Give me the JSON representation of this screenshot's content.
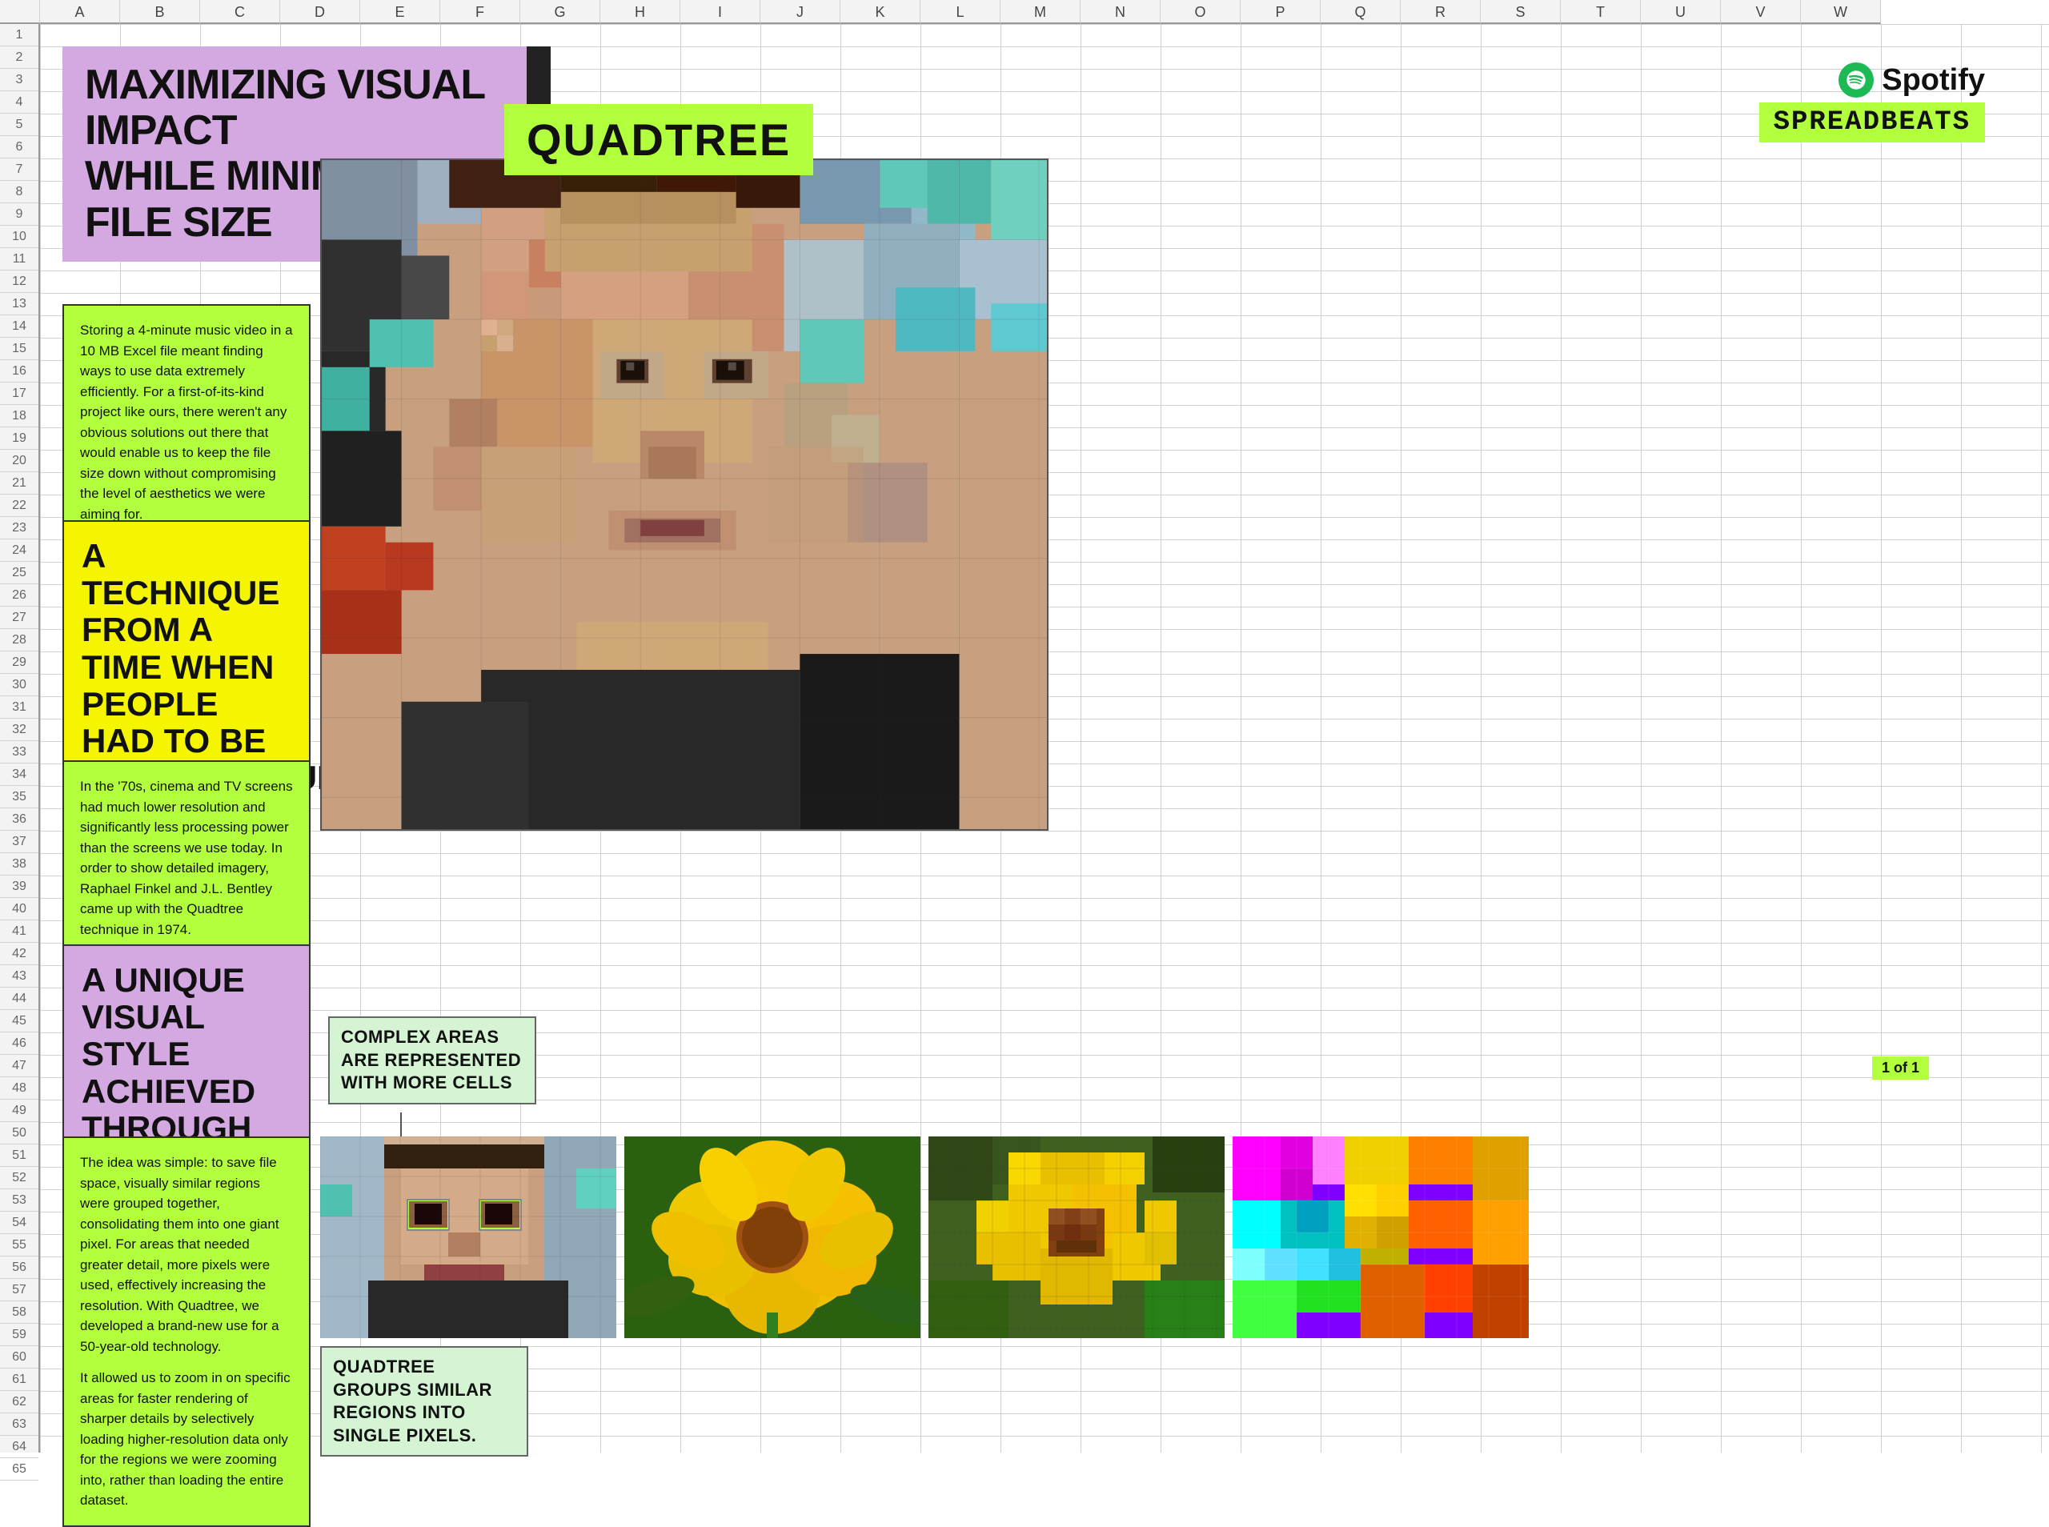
{
  "page": {
    "title": "Maximizing Visual Impact While Minimizing File Size",
    "quadtree_label": "QUADTREE",
    "spreadbeats": "SPREADBEATS"
  },
  "spotify": {
    "name": "Spotify",
    "logo_alt": "spotify-logo"
  },
  "title_block": {
    "line1": "MAXIMIZING VISUAL IMPACT",
    "line2": "WHILE MINIMIZING FILE SIZE"
  },
  "intro_box": {
    "text": "Storing a 4-minute music video in a 10 MB Excel file meant finding ways to use data extremely efficiently. For a first-of-its-kind project like ours, there weren't any obvious solutions out there that would enable us to keep the file size down without compromising the level of aesthetics we were aiming for."
  },
  "yellow_heading": {
    "text": "A TECHNIQUE FROM A TIME WHEN PEOPLE HAD TO BE RESOURCEFUL"
  },
  "seventies_box": {
    "text": "In the '70s, cinema and TV screens had much lower resolution and significantly less processing power than the screens we use today. In order to show detailed imagery, Raphael Finkel and J.L. Bentley came up with the Quadtree technique in 1974."
  },
  "purple_heading": {
    "text": "A UNIQUE VISUAL STYLE ACHIEVED THROUGH DATA EFFICIENCY"
  },
  "bottom_text_box": {
    "para1": "The idea was simple: to save file space, visually similar regions were grouped together, consolidating them into one giant pixel. For areas that needed greater detail, more pixels were used, effectively increasing the resolution. With Quadtree, we developed a brand-new use for a 50-year-old technology.",
    "para2": "It allowed us to zoom in on specific areas for faster rendering of sharper details by selectively loading higher-resolution data only for the regions we were zooming into, rather than loading the entire dataset."
  },
  "annotations": {
    "complex_areas": "COMPLEX AREAS ARE REPRESENTED WITH MORE CELLS",
    "quadtree_groups": "QUADTREE GROUPS SIMILAR REGIONS INTO SINGLE PIXELS.",
    "tot": "1 of 1"
  },
  "col_headers": [
    "A",
    "B",
    "C",
    "D",
    "E",
    "F",
    "G",
    "H",
    "I",
    "J",
    "K",
    "L",
    "M",
    "N",
    "O",
    "P",
    "Q",
    "R",
    "S",
    "T",
    "U",
    "V",
    "W"
  ],
  "row_count": 65
}
